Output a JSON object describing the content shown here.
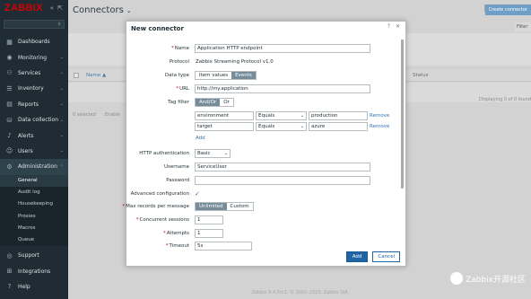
{
  "sidebar": {
    "logo": "ZABBIX",
    "nav": [
      {
        "label": "Dashboards",
        "icon": "dashboard-icon"
      },
      {
        "label": "Monitoring",
        "icon": "eye-icon"
      },
      {
        "label": "Services",
        "icon": "services-icon"
      },
      {
        "label": "Inventory",
        "icon": "inventory-icon"
      },
      {
        "label": "Reports",
        "icon": "reports-icon"
      },
      {
        "label": "Data collection",
        "icon": "data-collection-icon"
      },
      {
        "label": "Alerts",
        "icon": "bell-icon"
      },
      {
        "label": "Users",
        "icon": "user-icon"
      },
      {
        "label": "Administration",
        "icon": "gear-icon"
      }
    ],
    "admin_sub": [
      "General",
      "Audit log",
      "Housekeeping",
      "Proxies",
      "Macros",
      "Queue"
    ],
    "bottom": [
      {
        "label": "Support",
        "icon": "support-icon"
      },
      {
        "label": "Integrations",
        "icon": "integrations-icon"
      },
      {
        "label": "Help",
        "icon": "help-icon"
      }
    ]
  },
  "main": {
    "title": "Connectors",
    "create_button": "Create connector",
    "filter_tab": "Filter",
    "table": {
      "col_name": "Name ▲",
      "col_status": "Status"
    },
    "displaying": "Displaying 0 of 0 found",
    "selected": "0 selected",
    "enable": "Enable",
    "footer": "Zabbix 6.4.0rc1. © 2001–2023, Zabbix SIA"
  },
  "modal": {
    "title": "New connector",
    "name_label": "Name",
    "name_value": "Application HTTP endpoint",
    "protocol_label": "Protocol",
    "protocol_value": "Zabbix Streaming Protocol v1.0",
    "data_type_label": "Data type",
    "data_type_options": [
      "Item values",
      "Events"
    ],
    "url_label": "URL",
    "url_value": "http://my.application",
    "tag_filter_label": "Tag filter",
    "tag_filter_options": [
      "And/Or",
      "Or"
    ],
    "tags": [
      {
        "tag": "environment",
        "operator": "Equals",
        "value": "production",
        "remove": "Remove"
      },
      {
        "tag": "target",
        "operator": "Equals",
        "value": "azure",
        "remove": "Remove"
      }
    ],
    "add_link": "Add",
    "http_auth_label": "HTTP authentication",
    "http_auth_value": "Basic",
    "username_label": "Username",
    "username_value": "ServiceUser",
    "password_label": "Password",
    "password_value": "",
    "advanced_label": "Advanced configuration",
    "max_records_label": "Max records per message",
    "max_records_options": [
      "Unlimited",
      "Custom"
    ],
    "sessions_label": "Concurrent sessions",
    "sessions_value": "1",
    "attempts_label": "Attempts",
    "attempts_value": "1",
    "timeout_label": "Timeout",
    "timeout_value": "5s",
    "add_button": "Add",
    "cancel_button": "Cancel"
  },
  "watermark": "Zabbix开源社区"
}
